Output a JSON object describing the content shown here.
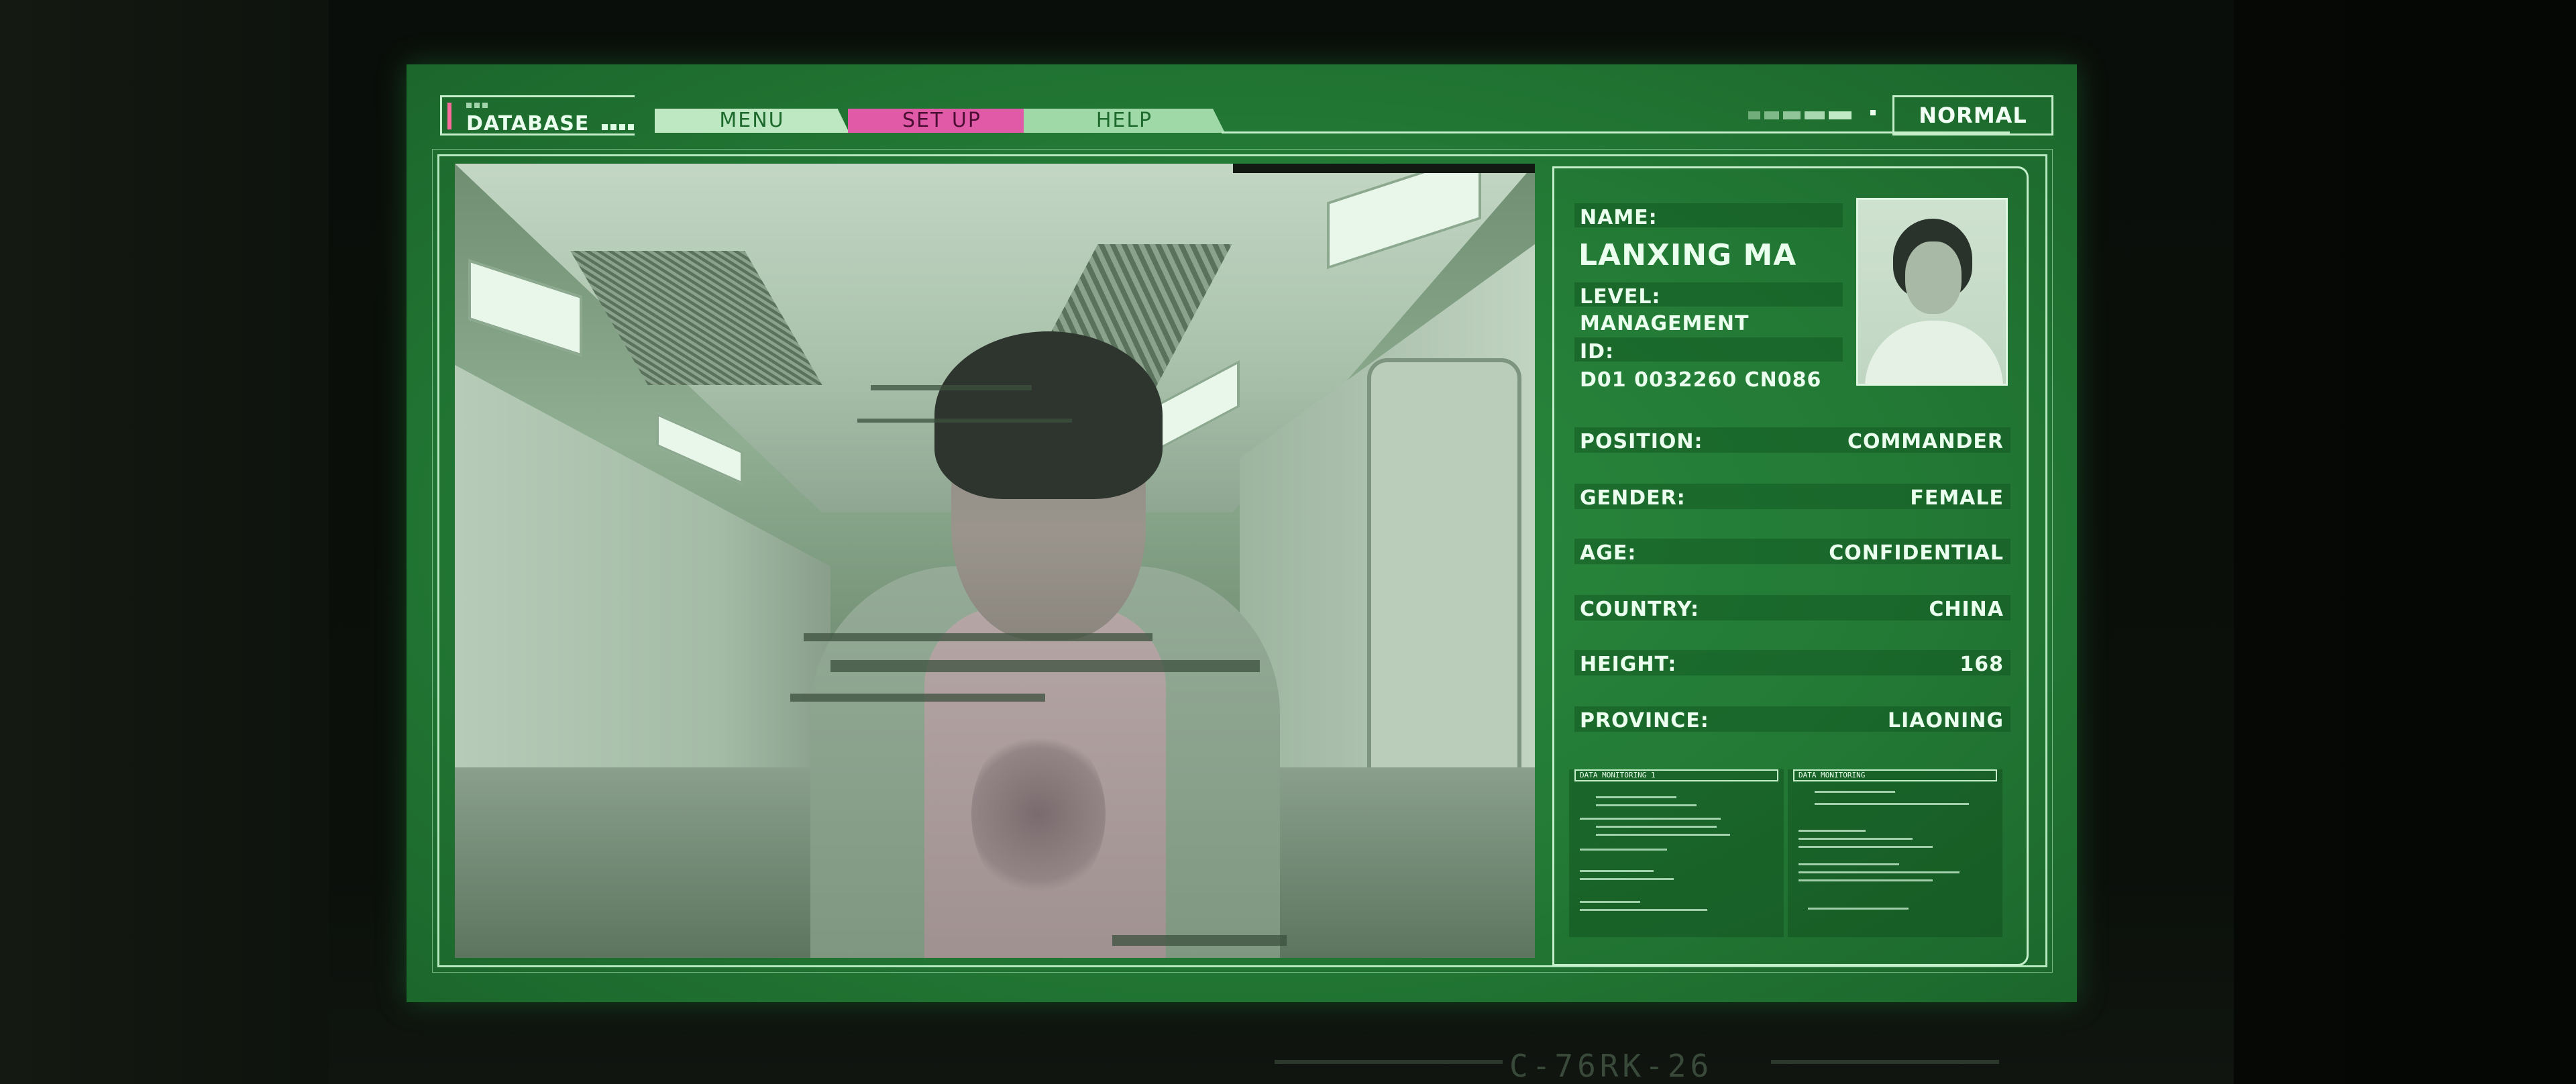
{
  "header": {
    "database_label": "DATABASE",
    "tabs": [
      {
        "label": "MENU"
      },
      {
        "label": "SET UP"
      },
      {
        "label": "HELP"
      }
    ],
    "status": "NORMAL"
  },
  "profile": {
    "name_label": "NAME:",
    "name": "LANXING MA",
    "level_label": "LEVEL:",
    "level": "MANAGEMENT",
    "id_label": "ID:",
    "id": "D01 0032260 CN086",
    "rows": [
      {
        "label": "POSITION:",
        "value": "COMMANDER"
      },
      {
        "label": "GENDER:",
        "value": "FEMALE"
      },
      {
        "label": "AGE:",
        "value": "CONFIDENTIAL"
      },
      {
        "label": "COUNTRY:",
        "value": "CHINA"
      },
      {
        "label": "HEIGHT:",
        "value": "168"
      },
      {
        "label": "PROVINCE:",
        "value": "LIAONING"
      }
    ]
  },
  "monitoring": {
    "left_title": "DATA MONITORING 1",
    "right_title": "DATA MONITORING"
  },
  "bezel_label": "C-76RK-26",
  "colors": {
    "screen_green": "#237a35",
    "frame_line": "#c4efca",
    "setup_tab": "#e05aa8",
    "db_accent": "#ff6a9a"
  },
  "icons": {
    "database_accent": "pink-bar-icon",
    "status_dot": "dot-icon"
  }
}
